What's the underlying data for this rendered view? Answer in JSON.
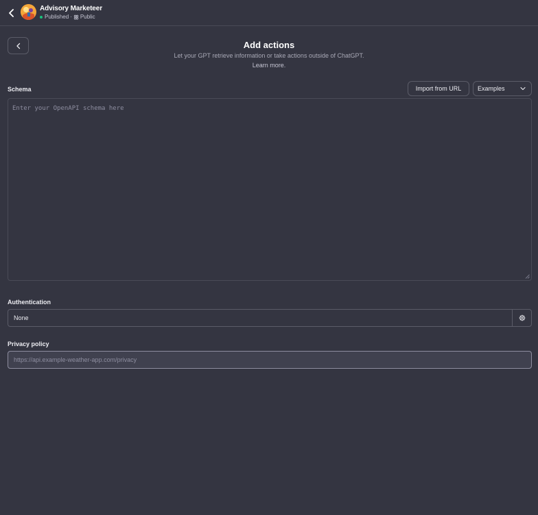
{
  "header": {
    "gpt_name": "Advisory Marketeer",
    "status": "Published",
    "separator": "·",
    "visibility": "Public"
  },
  "panel": {
    "title": "Add actions",
    "subtitle": "Let your GPT retrieve information or take actions outside of ChatGPT.",
    "learn_more": "Learn more."
  },
  "schema": {
    "label": "Schema",
    "import_button": "Import from URL",
    "examples_select": "Examples",
    "placeholder": "Enter your OpenAPI schema here"
  },
  "authentication": {
    "label": "Authentication",
    "value": "None"
  },
  "privacy": {
    "label": "Privacy policy",
    "placeholder": "https://api.example-weather-app.com/privacy"
  },
  "icons": {
    "back": "chevron-left-icon",
    "panel_back": "chevron-left-icon",
    "dropdown": "chevron-down-icon",
    "gear": "gear-icon",
    "visibility": "people-icon"
  },
  "colors": {
    "background": "#343541",
    "border": "#4a4b57",
    "status_green": "#19c37d",
    "text": "#ececf1",
    "muted": "#8e8ea0"
  }
}
